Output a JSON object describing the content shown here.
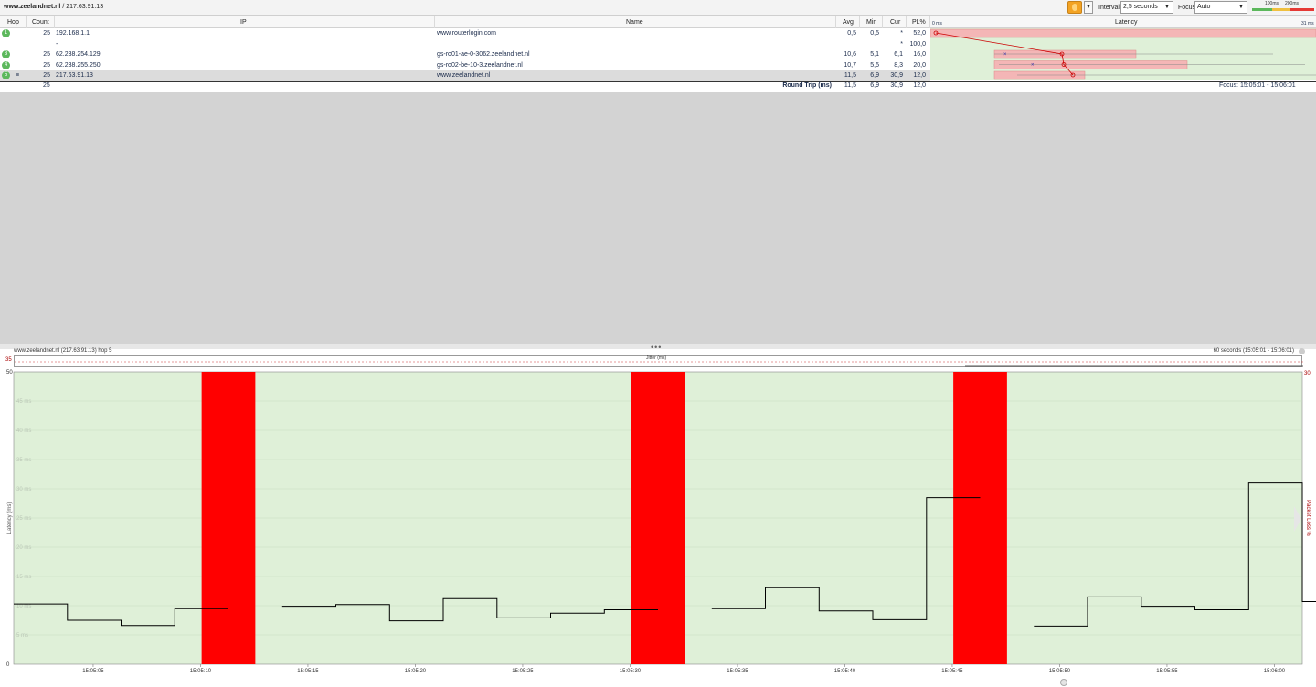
{
  "topbar": {
    "host": "www.zeelandnet.nl",
    "ip_suffix": " / 217.63.91.13",
    "interval_label": "Interval",
    "interval_value": "2,5 seconds",
    "focus_label": "Focus",
    "focus_value": "Auto",
    "scale_100": "100ms",
    "scale_200": "200ms",
    "color_good": "#5cb85c",
    "color_warn": "#f0c040",
    "color_bad": "#e53935"
  },
  "table": {
    "headers": {
      "hop": "Hop",
      "count": "Count",
      "ip": "IP",
      "name": "Name",
      "avg": "Avg",
      "min": "Min",
      "cur": "Cur",
      "pl": "PL%",
      "latency": "Latency"
    },
    "latency_axis_min": "0 ms",
    "latency_axis_max": "31 ms",
    "rows": [
      {
        "hop": "1",
        "count": "25",
        "ip": "192.168.1.1",
        "name": "www.routerlogin.com",
        "avg": "0,5",
        "min": "0,5",
        "cur": "*",
        "pl": "52,0"
      },
      {
        "hop": "",
        "count": "",
        "ip": "-",
        "name": "",
        "avg": "",
        "min": "",
        "cur": "*",
        "pl": "100,0"
      },
      {
        "hop": "3",
        "count": "25",
        "ip": "62.238.254.129",
        "name": "gs-ro01-ae-0-3062.zeelandnet.nl",
        "avg": "10,6",
        "min": "5,1",
        "cur": "6,1",
        "pl": "16,0"
      },
      {
        "hop": "4",
        "count": "25",
        "ip": "62.238.255.250",
        "name": "gs-ro02-be-10-3.zeelandnet.nl",
        "avg": "10,7",
        "min": "5,5",
        "cur": "8,3",
        "pl": "20,0"
      },
      {
        "hop": "5",
        "count": "25",
        "ip": "217.63.91.13",
        "name": "www.zeelandnet.nl",
        "avg": "11,5",
        "min": "6,9",
        "cur": "30,9",
        "pl": "12,0"
      }
    ],
    "summary": {
      "count": "25",
      "label": "Round Trip (ms)",
      "avg": "11,5",
      "min": "6,9",
      "cur": "30,9",
      "pl": "12,0",
      "focus": "Focus: 15:05:01 - 15:06:01"
    }
  },
  "graph": {
    "title": "www.zeelandnet.nl (217.63.91.13) hop 5",
    "range": "60 seconds (15:05:01 - 15:06:01)",
    "jitter_label": "Jitter (ms)",
    "jitter_max": "35"
  },
  "chart_data": {
    "type": "line",
    "title": "",
    "ylabel": "Latency (ms)",
    "y2label": "Packet Loss %",
    "ylim": [
      0,
      50
    ],
    "y_ticks": [
      "0",
      "5 ms",
      "10 ms",
      "15 ms",
      "20 ms",
      "25 ms",
      "30 ms",
      "35 ms",
      "40 ms",
      "45 ms",
      "50"
    ],
    "y2_max_label": "30",
    "x_ticks": [
      "15:05:05",
      "15:05:10",
      "15:05:15",
      "15:05:20",
      "15:05:25",
      "15:05:30",
      "15:05:35",
      "15:05:40",
      "15:05:45",
      "15:05:50",
      "15:05:55",
      "15:06:00"
    ],
    "x_start_seconds": 1.3,
    "x_end_seconds": 61.3,
    "series": [
      {
        "step_seconds": 2.5,
        "values": [
          10.3,
          7.5,
          6.6,
          9.5,
          null,
          9.9,
          10.2,
          7.4,
          11.2,
          7.9,
          8.7,
          9.3,
          null,
          9.5,
          13.1,
          9.1,
          7.6,
          28.5,
          null,
          6.5,
          11.5,
          9.9,
          9.3,
          31.0,
          10.7
        ],
        "color": "#000000"
      }
    ],
    "loss_bars_at_seconds": [
      11.3,
      31.3,
      46.3
    ],
    "loss_color": "#ff0000",
    "background_color": "#dff0d8"
  }
}
